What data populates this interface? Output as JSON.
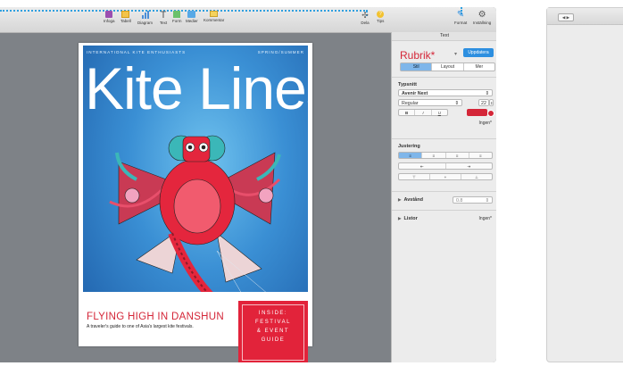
{
  "toolbar": {
    "items": [
      {
        "label": "Infoga",
        "icon": "insert-icon"
      },
      {
        "label": "Tabell",
        "icon": "table-icon"
      },
      {
        "label": "Diagram",
        "icon": "chart-icon"
      },
      {
        "label": "Text",
        "icon": "text-icon"
      },
      {
        "label": "Form",
        "icon": "shape-icon"
      },
      {
        "label": "Medier",
        "icon": "media-icon"
      },
      {
        "label": "Kommentar",
        "icon": "comment-icon"
      }
    ],
    "right_items": [
      {
        "label": "Dela",
        "icon": "share-icon"
      },
      {
        "label": "Tips",
        "icon": "tips-icon"
      }
    ],
    "far_right_items": [
      {
        "label": "Format",
        "icon": "format-brush-icon"
      },
      {
        "label": "Inställning",
        "icon": "settings-gear-icon"
      }
    ]
  },
  "cover": {
    "top_left": "INTERNATIONAL KITE ENTHUSIASTS",
    "top_right": "SPRING/SUMMER",
    "masthead": "Kite Lines",
    "headline": "FLYING HIGH IN DANSHUN",
    "subline": "A traveler's guide to one of Asia's largest kite festivals.",
    "inside_lines": [
      "INSIDE:",
      "FESTIVAL",
      "& EVENT",
      "GUIDE"
    ]
  },
  "panel": {
    "title": "Text",
    "style_name": "Rubrik*",
    "update_button": "Uppdatera",
    "tabs": [
      "Stil",
      "Layout",
      "Mer"
    ],
    "active_tab": "Stil",
    "font_heading": "Typsnitt",
    "font_family": "Avenir Next",
    "font_style": "Regular",
    "font_size": "22",
    "bold": "B",
    "italic": "I",
    "underline": "U",
    "text_color": "#d42638",
    "char_style": "Ingen*",
    "align_heading": "Justering",
    "spacing_label": "Avstånd",
    "spacing_value": "0.8",
    "lists_label": "Listor",
    "lists_value": "Ingen*"
  },
  "second_window": {
    "nav_label": "◀ ▶"
  },
  "colors": {
    "accent_blue": "#2d8fe0",
    "cover_red": "#d42638"
  }
}
